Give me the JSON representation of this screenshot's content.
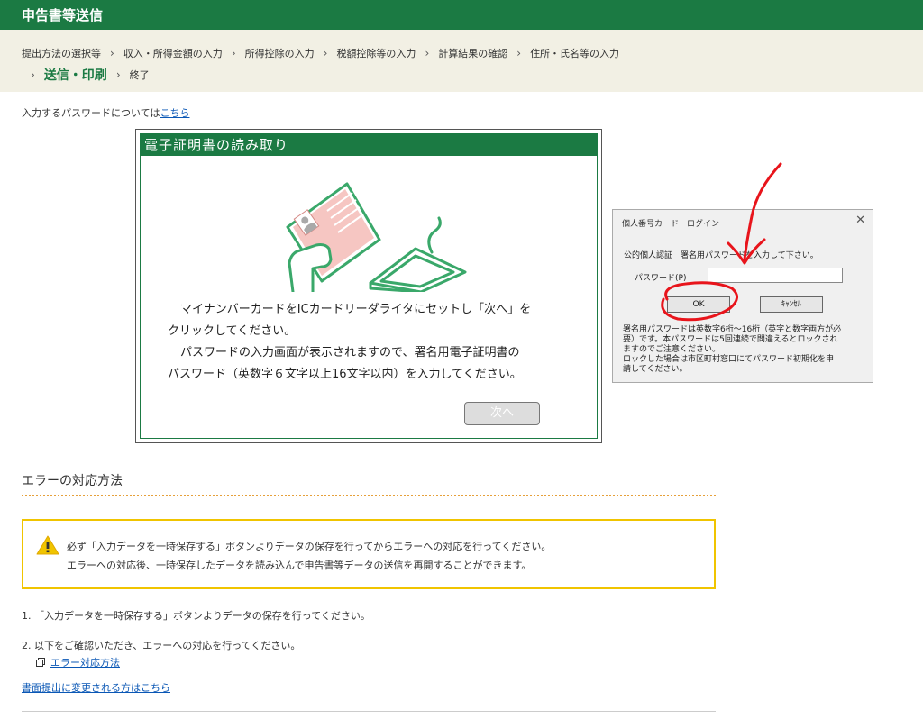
{
  "header": {
    "title": "申告書等送信"
  },
  "breadcrumb": {
    "steps": [
      "提出方法の選択等",
      "収入・所得金額の入力",
      "所得控除の入力",
      "税額控除等の入力",
      "計算結果の確認",
      "住所・氏名等の入力"
    ],
    "current": "送信・印刷",
    "last": "終了"
  },
  "password_note": {
    "text": "入力するパスワードについては",
    "link": "こちら"
  },
  "cert_panel": {
    "title": "電子証明書の読み取り",
    "lines": [
      "マイナンバーカードをICカードリーダライタにセットし「次へ」を",
      "クリックしてください。",
      "パスワードの入力画面が表示されますので、署名用電子証明書の",
      "パスワード（英数字６文字以上16文字以内）を入力してください。"
    ],
    "next_label": "次へ"
  },
  "login_dialog": {
    "title": "個人番号カード　ログイン",
    "instruction": "公的個人認証　署名用パスワードを入力して下さい。",
    "password_label": "パスワード(P)",
    "ok_label": "OK",
    "cancel_label": "ｷｬﾝｾﾙ",
    "note_lines": [
      "署名用パスワードは英数字6桁～16桁（英字と数字両方が必",
      "要）です。本パスワードは5回連続で間違えるとロックされ",
      "ますのでご注意ください。",
      "ロックした場合は市区町村窓口にてパスワード初期化を申",
      "請してください。"
    ]
  },
  "error_section": {
    "heading": "エラーの対応方法",
    "warning_line1": "必ず「入力データを一時保存する」ボタンよりデータの保存を行ってからエラーへの対応を行ってください。",
    "warning_line2": "エラーへの対応後、一時保存したデータを読み込んで申告書等データの送信を再開することができます。",
    "step1": "1.  「入力データを一時保存する」ボタンよりデータの保存を行ってください。",
    "step2": "2.  以下をご確認いただき、エラーへの対応を行ってください。",
    "error_link": "エラー対応方法",
    "paper_link": "書面提出に変更される方はこちら"
  },
  "colors": {
    "brand_green": "#1b7a43",
    "link_blue": "#0a57b5",
    "warn_yellow": "#f0c400",
    "annotation_red": "#e8141b"
  }
}
